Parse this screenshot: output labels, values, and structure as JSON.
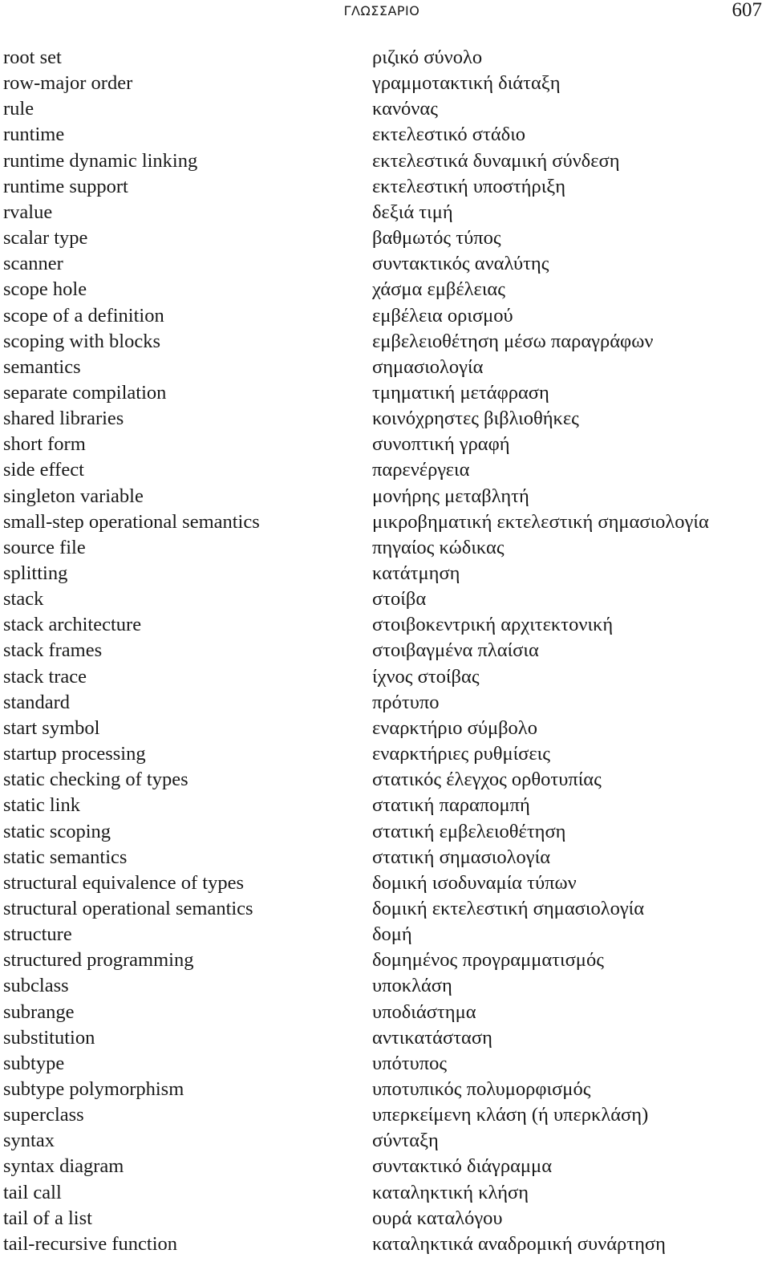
{
  "header": {
    "running_title": "ΓΛΩΣΣΑΡΙΟ",
    "page_number": "607"
  },
  "entries": [
    {
      "english": "root set",
      "greek": "ριζικό σύνολο"
    },
    {
      "english": "row-major order",
      "greek": "γραμμοτακτική διάταξη"
    },
    {
      "english": "rule",
      "greek": "κανόνας"
    },
    {
      "english": "runtime",
      "greek": "εκτελεστικό στάδιο"
    },
    {
      "english": "runtime dynamic linking",
      "greek": "εκτελεστικά δυναμική σύνδεση"
    },
    {
      "english": "runtime support",
      "greek": "εκτελεστική υποστήριξη"
    },
    {
      "english": "rvalue",
      "greek": "δεξιά τιμή"
    },
    {
      "english": "scalar type",
      "greek": "βαθμωτός τύπος"
    },
    {
      "english": "scanner",
      "greek": "συντακτικός αναλύτης"
    },
    {
      "english": "scope hole",
      "greek": "χάσμα εμβέλειας"
    },
    {
      "english": "scope of a definition",
      "greek": "εμβέλεια ορισμού"
    },
    {
      "english": "scoping with blocks",
      "greek": "εμβελειοθέτηση μέσω παραγράφων"
    },
    {
      "english": "semantics",
      "greek": "σημασιολογία"
    },
    {
      "english": "separate compilation",
      "greek": "τμηματική μετάφραση"
    },
    {
      "english": "shared libraries",
      "greek": "κοινόχρηστες βιβλιοθήκες"
    },
    {
      "english": "short form",
      "greek": "συνοπτική γραφή"
    },
    {
      "english": "side effect",
      "greek": "παρενέργεια"
    },
    {
      "english": "singleton variable",
      "greek": "μονήρης μεταβλητή"
    },
    {
      "english": "small-step operational semantics",
      "greek": "μικροβηματική εκτελεστική σημασιολογία"
    },
    {
      "english": "source file",
      "greek": "πηγαίος κώδικας"
    },
    {
      "english": "splitting",
      "greek": "κατάτμηση"
    },
    {
      "english": "stack",
      "greek": "στοίβα"
    },
    {
      "english": "stack architecture",
      "greek": "στοιβοκεντρική αρχιτεκτονική"
    },
    {
      "english": "stack frames",
      "greek": "στοιβαγμένα πλαίσια"
    },
    {
      "english": "stack trace",
      "greek": "ίχνος στοίβας"
    },
    {
      "english": "standard",
      "greek": "πρότυπο"
    },
    {
      "english": "start symbol",
      "greek": "εναρκτήριο σύμβολο"
    },
    {
      "english": "startup processing",
      "greek": "εναρκτήριες ρυθμίσεις"
    },
    {
      "english": "static checking of types",
      "greek": "στατικός έλεγχος ορθοτυπίας"
    },
    {
      "english": "static link",
      "greek": "στατική παραπομπή"
    },
    {
      "english": "static scoping",
      "greek": "στατική εμβελειοθέτηση"
    },
    {
      "english": "static semantics",
      "greek": "στατική σημασιολογία"
    },
    {
      "english": "structural equivalence of types",
      "greek": "δομική ισοδυναμία τύπων"
    },
    {
      "english": "structural operational semantics",
      "greek": "δομική εκτελεστική σημασιολογία"
    },
    {
      "english": "structure",
      "greek": "δομή"
    },
    {
      "english": "structured programming",
      "greek": "δομημένος προγραμματισμός"
    },
    {
      "english": "subclass",
      "greek": "υποκλάση"
    },
    {
      "english": "subrange",
      "greek": "υποδιάστημα"
    },
    {
      "english": "substitution",
      "greek": "αντικατάσταση"
    },
    {
      "english": "subtype",
      "greek": "υπότυπος"
    },
    {
      "english": "subtype polymorphism",
      "greek": "υποτυπικός πολυμορφισμός"
    },
    {
      "english": "superclass",
      "greek": "υπερκείμενη κλάση (ή υπερκλάση)"
    },
    {
      "english": "syntax",
      "greek": "σύνταξη"
    },
    {
      "english": "syntax diagram",
      "greek": "συντακτικό διάγραμμα"
    },
    {
      "english": "tail call",
      "greek": "καταληκτική κλήση"
    },
    {
      "english": "tail of a list",
      "greek": "ουρά καταλόγου"
    },
    {
      "english": "tail-recursive function",
      "greek": "καταληκτικά αναδρομική συνάρτηση"
    }
  ]
}
